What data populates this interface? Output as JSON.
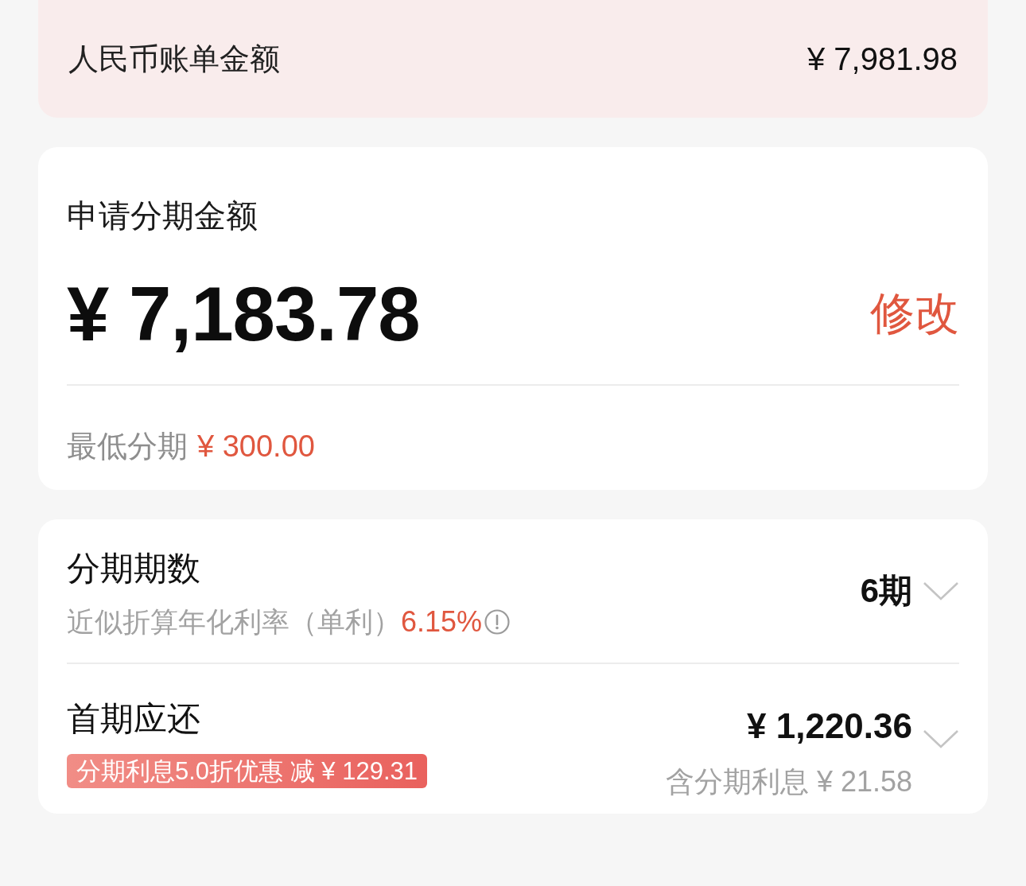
{
  "bill_summary": {
    "label": "人民币账单金额",
    "amount": "¥ 7,981.98"
  },
  "apply_card": {
    "title": "申请分期金额",
    "amount": "¥ 7,183.78",
    "edit_link": "修改",
    "minimum": {
      "label": "最低分期",
      "amount": "¥ 300.00"
    }
  },
  "plan_card": {
    "rows": [
      {
        "kind": "term",
        "label": "分期期数",
        "note": "近似折算年化利率（单利）",
        "rate": "6.15%",
        "value": "6期"
      },
      {
        "kind": "first_payment",
        "label": "首期应还",
        "badge": "分期利息5.0折优惠 减 ¥ 129.31",
        "value": "¥ 1,220.36",
        "sub_value": "含分期利息 ¥ 21.58"
      }
    ]
  }
}
